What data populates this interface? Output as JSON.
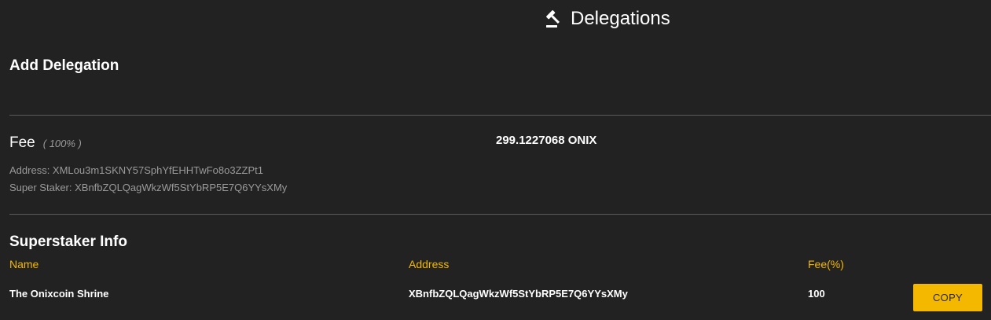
{
  "header": {
    "title": "Delegations",
    "icon": "gavel-icon"
  },
  "add_delegation": {
    "title": "Add Delegation"
  },
  "fee": {
    "label": "Fee",
    "percent": "( 100% )",
    "amount": "299.1227068 ONIX",
    "address_line": "Address: XMLou3m1SKNY57SphYfEHHTwFo8o3ZZPt1",
    "super_staker_line": "Super Staker: XBnfbZQLQagWkzWf5StYbRP5E7Q6YYsXMy"
  },
  "superstaker_info": {
    "title": "Superstaker Info",
    "columns": {
      "name": "Name",
      "address": "Address",
      "fee": "Fee(%)"
    },
    "row": {
      "name": "The Onixcoin Shrine",
      "address": "XBnfbZQLQagWkzWf5StYbRP5E7Q6YYsXMy",
      "fee": "100"
    },
    "copy_label": "COPY"
  },
  "colors": {
    "background": "#222222",
    "accent": "#f5b800",
    "muted_text": "#9a9a9a",
    "divider": "#5a5a5a"
  }
}
